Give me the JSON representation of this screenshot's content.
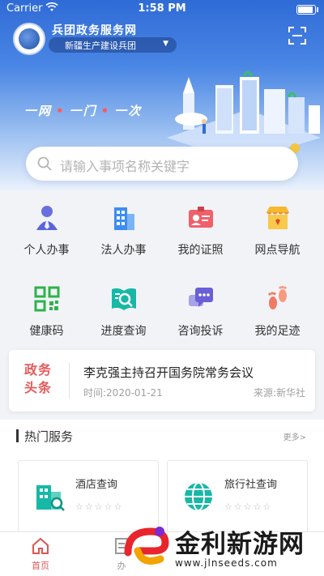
{
  "status_bar": {
    "carrier": "Carrier",
    "time": "1:58 PM"
  },
  "header": {
    "site_name": "兵团政务服务网",
    "region": "新疆生产建设兵团",
    "slogan": [
      "一网",
      "一门",
      "一次"
    ]
  },
  "search": {
    "placeholder": "请输入事项名称关键字"
  },
  "services": [
    {
      "label": "个人办事",
      "icon": "person-icon"
    },
    {
      "label": "法人办事",
      "icon": "building-icon"
    },
    {
      "label": "我的证照",
      "icon": "id-card-icon"
    },
    {
      "label": "网点导航",
      "icon": "store-icon"
    },
    {
      "label": "健康码",
      "icon": "qr-code-icon"
    },
    {
      "label": "进度查询",
      "icon": "progress-search-icon"
    },
    {
      "label": "咨询投诉",
      "icon": "chat-icon"
    },
    {
      "label": "我的足迹",
      "icon": "footprint-icon"
    }
  ],
  "news": {
    "tag_line1": "政务",
    "tag_line2": "头条",
    "title": "李克强主持召开国务院常务会议",
    "date": "时间:2020-01-21",
    "source": "来源:新华社"
  },
  "hot_services": {
    "title": "热门服务",
    "more": "更多>",
    "cards": [
      {
        "name": "酒店查询",
        "rating_display": "☆☆☆☆☆",
        "icon": "hotel-search-icon"
      },
      {
        "name": "旅行社查询",
        "rating_display": "☆☆☆☆☆",
        "icon": "globe-icon"
      }
    ]
  },
  "tabbar": {
    "home_label": "首页",
    "second_label": "办"
  },
  "watermark": {
    "text": "金利新游网",
    "url": "www.jlnseeds.com"
  },
  "colors": {
    "primary": "#2f6bd6",
    "accent_red": "#e55b5b",
    "teal": "#17b8a6"
  }
}
